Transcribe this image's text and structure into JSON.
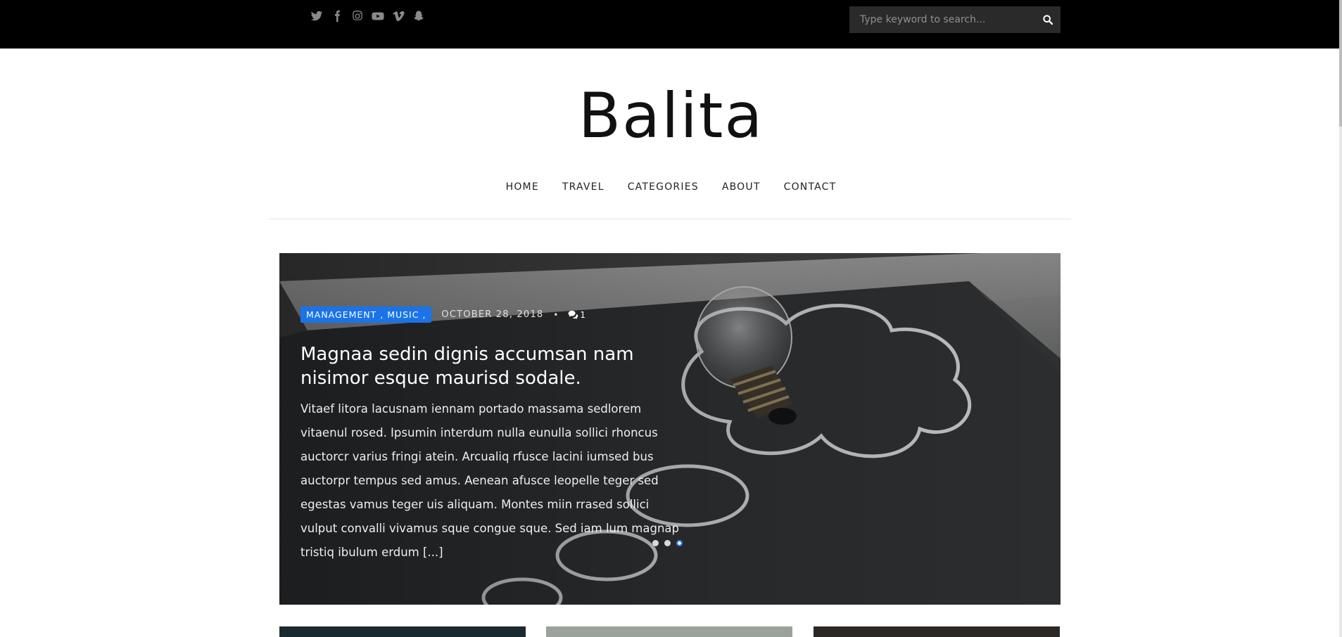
{
  "topbar": {
    "social_icons": [
      "twitter-icon",
      "facebook-icon",
      "instagram-icon",
      "youtube-icon",
      "vimeo-icon",
      "snapchat-icon"
    ],
    "search": {
      "placeholder": "Type keyword to search..."
    }
  },
  "header": {
    "site_title": "Balita"
  },
  "nav": {
    "items": [
      "HOME",
      "TRAVEL",
      "CATEGORIES",
      "ABOUT",
      "CONTACT"
    ]
  },
  "hero": {
    "categories": "MANAGEMENT , MUSIC ,",
    "date": "OCTOBER 28, 2018",
    "separator": "•",
    "comment_count": "1",
    "title": "Magnaa sedin dignis accumsan nam nisimor esque maurisd sodale.",
    "excerpt": "Vitaef litora lacusnam iennam portado massama sedlorem vitaenul rosed. Ipsumin interdum nulla eunulla sollici rhoncus auctorcr varius fringi atein. Arcualiq rfusce lacini iumsed bus auctorpr tempus sed amus. Aenean afusce leopelle teger sed egestas vamus teger uis aliquam. Montes miin rrased sollici vulput convalli vivamus sque congue sque. Sed iam lum magnap tristiq ibulum erdum [...]",
    "slides": 3,
    "active_slide": 3
  },
  "colors": {
    "topbar_bg": "#000000",
    "accent": "#1a73e8",
    "search_bg": "#2a2a2a"
  }
}
